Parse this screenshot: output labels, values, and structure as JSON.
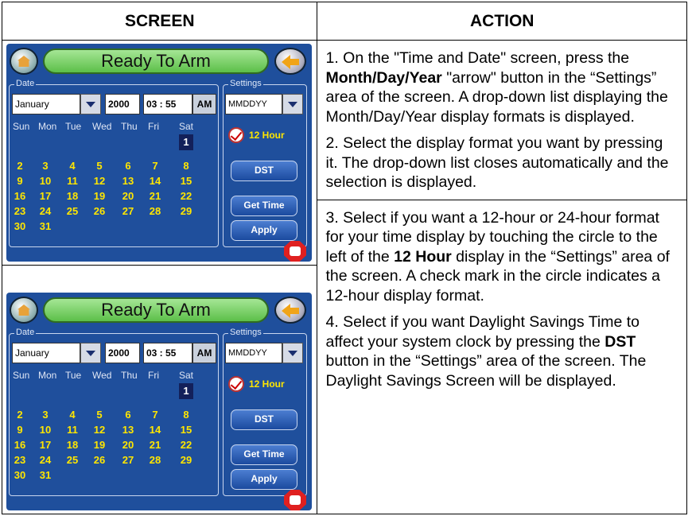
{
  "table": {
    "header_screen": "SCREEN",
    "header_action": "ACTION"
  },
  "device": {
    "title": "Ready To Arm",
    "date_group_label": "Date",
    "settings_group_label": "Settings",
    "month": "January",
    "year": "2000",
    "time": "03 : 55",
    "ampm": "AM",
    "format": "MMDDYY",
    "days_of_week": [
      "Sun",
      "Mon",
      "Tue",
      "Wed",
      "Thu",
      "Fri",
      "Sat"
    ],
    "calendar_days": [
      [
        "1"
      ],
      [
        "2",
        "3",
        "4",
        "5",
        "6",
        "7",
        "8"
      ],
      [
        "9",
        "10",
        "11",
        "12",
        "13",
        "14",
        "15"
      ],
      [
        "16",
        "17",
        "18",
        "19",
        "20",
        "21",
        "22"
      ],
      [
        "23",
        "24",
        "25",
        "26",
        "27",
        "28",
        "29"
      ],
      [
        "30",
        "31"
      ]
    ],
    "selected_day": "1",
    "hour_label": "12 Hour",
    "dst_label": "DST",
    "get_time_label": "Get Time",
    "apply_label": "Apply"
  },
  "steps": [
    {
      "parts": [
        "1.  On the \"Time and Date\" screen, press the ",
        "Month/Day/Year",
        " \"arrow\" button in the “Settings” area of the screen.  A drop-down list displaying the Month/Day/Year display formats is displayed."
      ]
    },
    {
      "parts": [
        "2.  Select the display format you want by pressing it.  The drop-down list closes automatically and the selection is displayed.",
        "",
        ""
      ]
    },
    {
      "parts": [
        "3.  Select if you want a 12-hour or 24-hour format for your time display by touching the circle to the left of the ",
        "12 Hour",
        " display in the “Settings” area of the screen.  A check mark in the circle indicates a 12-hour display format."
      ]
    },
    {
      "parts": [
        "4.  Select if you want Daylight Savings Time to affect your system clock by pressing the ",
        "DST",
        " button in the “Settings” area of the screen.  The Daylight Savings Screen will be displayed."
      ]
    }
  ]
}
